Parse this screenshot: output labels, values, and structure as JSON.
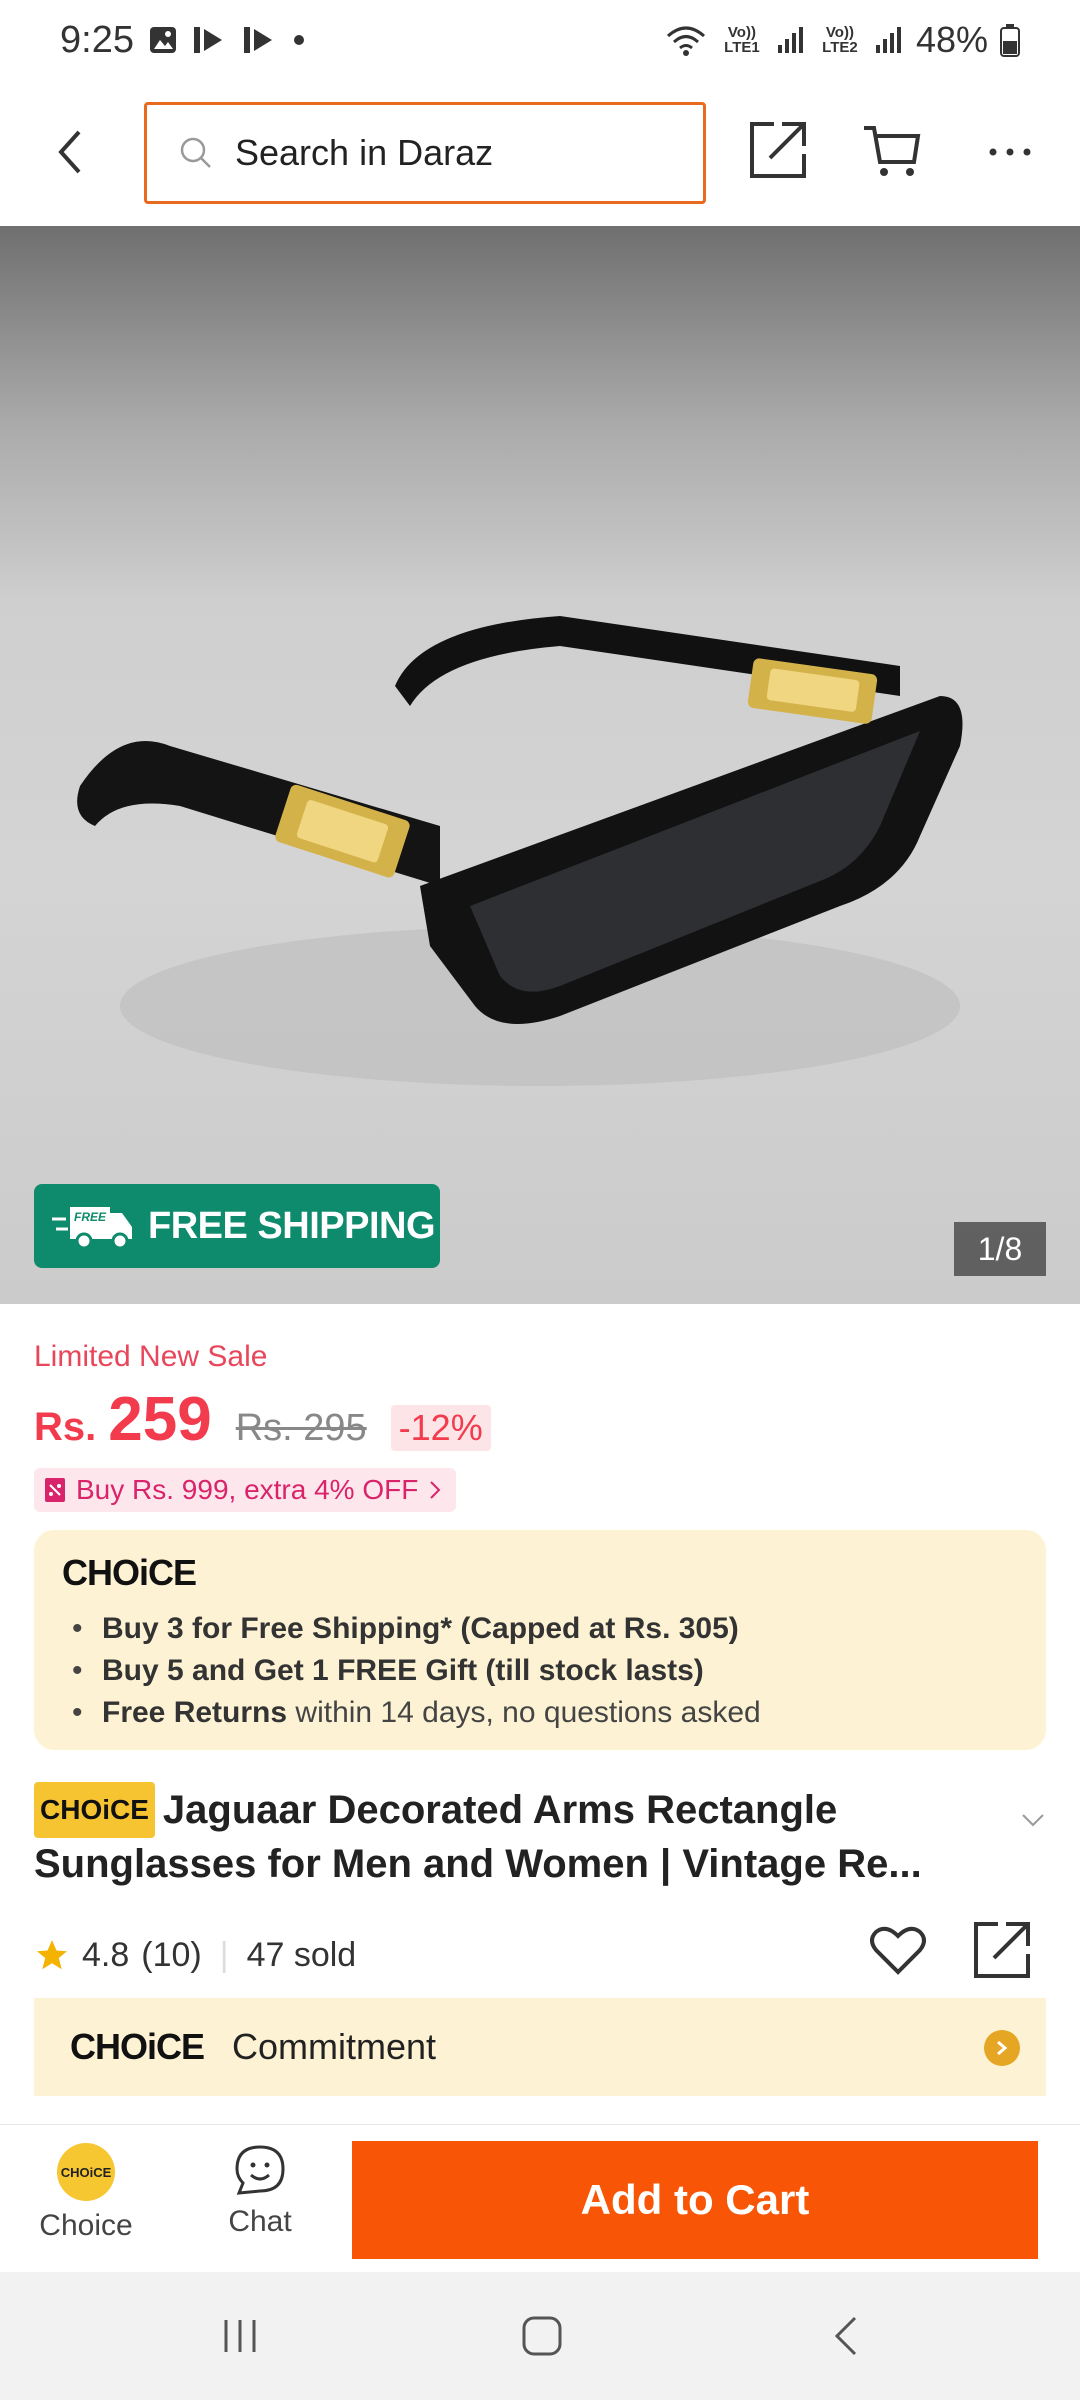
{
  "status_bar": {
    "time": "9:25",
    "battery": "48%",
    "sim1": "Vo)) LTE1",
    "sim2": "Vo)) LTE2"
  },
  "search": {
    "placeholder": "Search in Daraz"
  },
  "product": {
    "image_counter": "1/8",
    "free_shipping_label": "FREE SHIPPING",
    "free_tag": "FREE",
    "sale_label": "Limited New Sale",
    "currency": "Rs.",
    "price": "259",
    "original_price": "Rs. 295",
    "discount": "-12%",
    "promo": "Buy Rs. 999, extra 4% OFF",
    "choice_logo": "CHOiCE",
    "choice_benefits": [
      {
        "bold": "Buy 3 for  Free Shipping* (Capped at Rs. 305)",
        "rest": ""
      },
      {
        "bold": "Buy 5 and Get 1 FREE Gift (till stock lasts)",
        "rest": ""
      },
      {
        "bold": "Free Returns",
        "rest": " within 14 days, no questions asked"
      }
    ],
    "title_badge": "CHOiCE",
    "title": "Jaguaar Decorated Arms Rectangle Sunglasses for Men and Women | Vintage Re...",
    "rating": "4.8",
    "reviews": "(10)",
    "sold": "47 sold",
    "commitment_logo": "CHOiCE",
    "commitment_label": "Commitment"
  },
  "action_bar": {
    "choice_label": "Choice",
    "choice_coin": "CHOiCE",
    "chat_label": "Chat",
    "add_to_cart": "Add to Cart"
  },
  "colors": {
    "accent": "#f85606",
    "price": "#f23b4c",
    "free_shipping": "#0e8a6c",
    "choice_bg": "#fdf3d4"
  }
}
